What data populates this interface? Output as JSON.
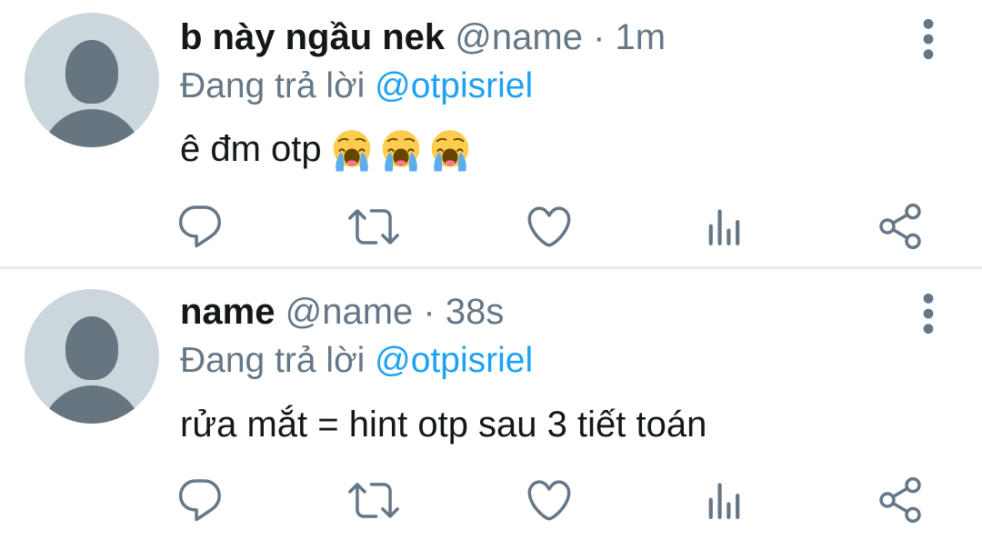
{
  "tweets": [
    {
      "display_name": "b này ngầu nek",
      "handle": "@name",
      "separator": "·",
      "time": "1m",
      "replying_prefix": "Đang trả lời",
      "replying_to": "@otpisriel",
      "text": "ê đm otp",
      "emojis": [
        "loudly-crying-face",
        "loudly-crying-face",
        "loudly-crying-face"
      ]
    },
    {
      "display_name": "name",
      "handle": "@name",
      "separator": "·",
      "time": "38s",
      "replying_prefix": "Đang trả lời",
      "replying_to": "@otpisriel",
      "text": "rửa mắt = hint otp sau 3 tiết toán",
      "emojis": []
    }
  ],
  "actions": [
    "reply-icon",
    "retweet-icon",
    "like-icon",
    "analytics-icon",
    "share-icon"
  ],
  "colors": {
    "text": "#14171a",
    "secondary": "#657786",
    "mention": "#1da1f2",
    "divider": "#e6ecf0",
    "avatar_bg": "#ccd6dd",
    "avatar_fg": "#66757f"
  }
}
